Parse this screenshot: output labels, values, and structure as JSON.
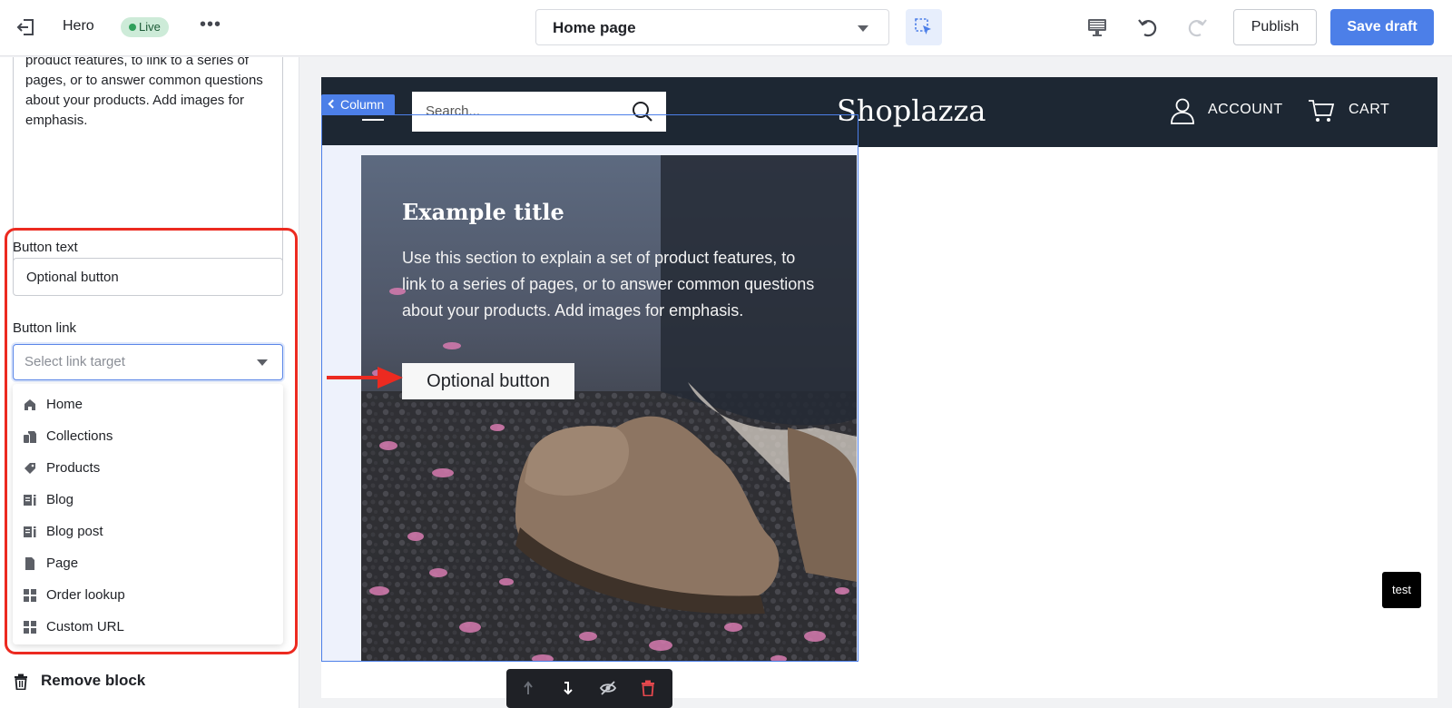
{
  "topbar": {
    "title": "Hero",
    "status": "Live",
    "page_select": "Home page",
    "publish_label": "Publish",
    "save_label": "Save draft"
  },
  "sidebar": {
    "description_text": "product features, to link to a series of pages, or to answer common questions about your products. Add images for emphasis.",
    "button_text_label": "Button text",
    "button_text_value": "Optional button",
    "button_link_label": "Button link",
    "button_link_placeholder": "Select link target",
    "link_options": [
      {
        "label": "Home",
        "icon": "home-icon"
      },
      {
        "label": "Collections",
        "icon": "collections-icon"
      },
      {
        "label": "Products",
        "icon": "tag-icon"
      },
      {
        "label": "Blog",
        "icon": "blog-icon"
      },
      {
        "label": "Blog post",
        "icon": "blog-post-icon"
      },
      {
        "label": "Page",
        "icon": "page-icon"
      },
      {
        "label": "Order lookup",
        "icon": "grid-icon"
      },
      {
        "label": "Custom URL",
        "icon": "grid-icon"
      }
    ],
    "remove_block_label": "Remove block"
  },
  "preview": {
    "search_placeholder": "Search...",
    "logo": "Shoplazza",
    "account_label": "ACCOUNT",
    "cart_label": "CART",
    "column_tag": "Column",
    "hero_title": "Example title",
    "hero_body": "Use this section to explain a set of product features, to link to a series of pages, or to answer common questions about your products. Add images for emphasis.",
    "hero_button": "Optional button",
    "test_badge": "test"
  },
  "colors": {
    "accent": "#4c7fe8",
    "header_bg": "#1d2733",
    "highlight": "#ec2a20",
    "live_bg": "#cdebd8"
  }
}
